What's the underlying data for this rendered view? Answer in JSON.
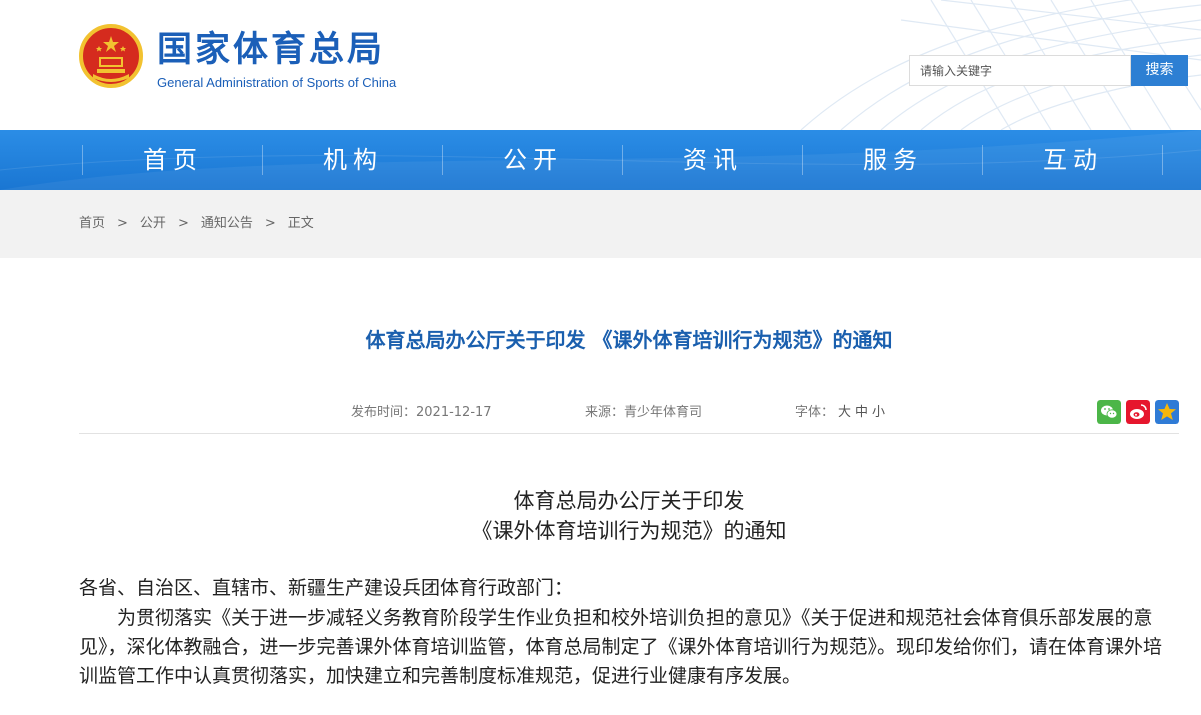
{
  "header": {
    "site_title": "国家体育总局",
    "site_subtitle": "General Administration of Sports of China",
    "search_placeholder": "请输入关键字",
    "search_button": "搜索"
  },
  "nav": {
    "items": [
      "首页",
      "机构",
      "公开",
      "资讯",
      "服务",
      "互动"
    ]
  },
  "breadcrumb": {
    "items": [
      "首页",
      "公开",
      "通知公告",
      "正文"
    ],
    "separator": ">"
  },
  "article": {
    "title": "体育总局办公厅关于印发 《课外体育培训行为规范》的通知",
    "publish_label": "发布时间：",
    "publish_date": "2021-12-17",
    "source_label": "来源：",
    "source": "青少年体育司",
    "font_label": "字体：",
    "font_large": "大",
    "font_medium": "中",
    "font_small": "小",
    "doc_heading_1": "体育总局办公厅关于印发",
    "doc_heading_2": "《课外体育培训行为规范》的通知",
    "salutation": "各省、自治区、直辖市、新疆生产建设兵团体育行政部门：",
    "paragraph_1": "为贯彻落实《关于进一步减轻义务教育阶段学生作业负担和校外培训负担的意见》《关于促进和规范社会体育俱乐部发展的意见》，深化体教融合，进一步完善课外体育培训监管，体育总局制定了《课外体育培训行为规范》。现印发给你们，请在体育课外培训监管工作中认真贯彻落实，加快建立和完善制度标准规范，促进行业健康有序发展。"
  },
  "share": {
    "icons": [
      "wechat-icon",
      "weibo-icon",
      "qzone-icon"
    ]
  },
  "colors": {
    "brand_blue": "#1b5fb8",
    "nav_blue": "#2b8de6",
    "title_blue": "#1a5fae",
    "search_button": "#2d7fd3",
    "wechat": "#4cb648",
    "weibo": "#e6162d",
    "qzone": "#f5b60a"
  }
}
